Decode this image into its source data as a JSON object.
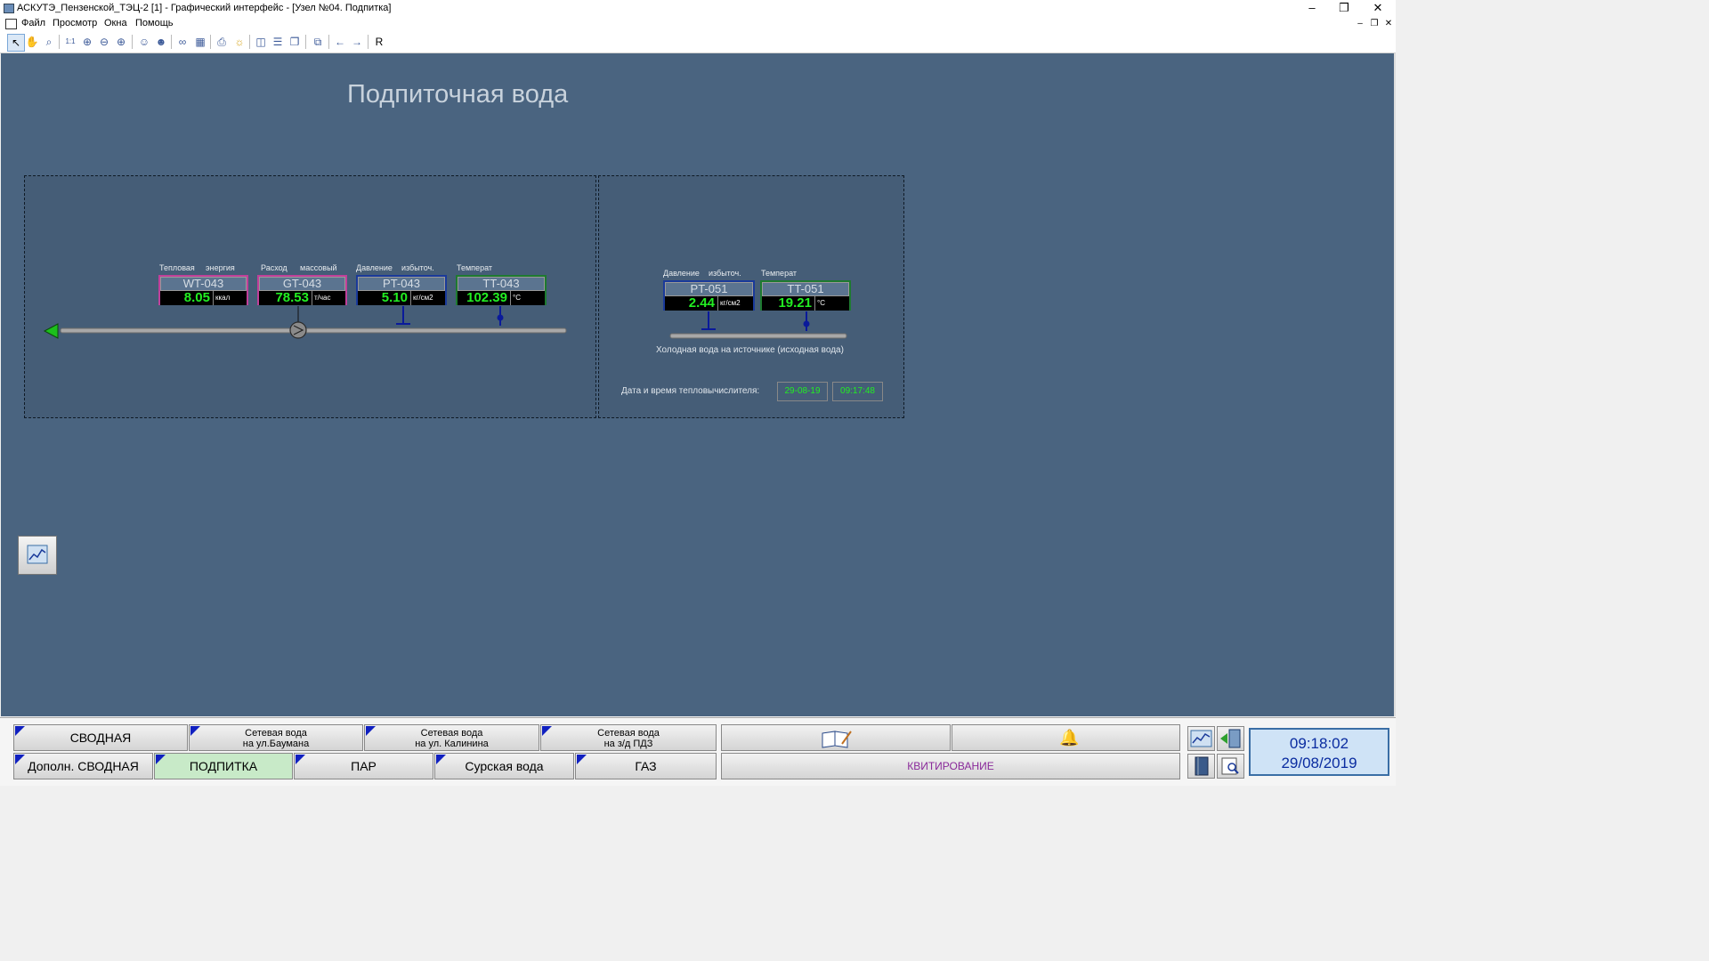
{
  "window": {
    "title": "АСКУТЭ_Пензенской_ТЭЦ-2 [1] - Графический интерфейс - [Узел №04. Подпитка]",
    "controls": {
      "minimize": "–",
      "restore": "❐",
      "close": "✕"
    }
  },
  "menu": [
    "Файл",
    "Просмотр",
    "Окна",
    "Помощь"
  ],
  "toolbar": {
    "r_label": "R"
  },
  "page": {
    "title": "Подпиточная вода"
  },
  "left_group": {
    "instruments": [
      {
        "label1": "Тепловая",
        "label2": "энергия",
        "tag": "WT-043",
        "value": "8.05",
        "unit": "ккал",
        "border": "#c0409a"
      },
      {
        "label1": "Расход",
        "label2": "массовый",
        "tag": "GT-043",
        "value": "78.53",
        "unit": "т/час",
        "border": "#c0409a"
      },
      {
        "label1": "Давление",
        "label2": "избыточ.",
        "tag": "PT-043",
        "value": "5.10",
        "unit": "кг/см2",
        "border": "#1a3a9a"
      },
      {
        "label1": "Температ",
        "label2": "",
        "tag": "TT-043",
        "value": "102.39",
        "unit": "°C",
        "border": "#1e7a30"
      }
    ]
  },
  "right_group": {
    "instruments": [
      {
        "label1": "Давление",
        "label2": "избыточ.",
        "tag": "PT-051",
        "value": "2.44",
        "unit": "кг/см2",
        "border": "#1a3a9a"
      },
      {
        "label1": "Температ",
        "label2": "",
        "tag": "TT-051",
        "value": "19.21",
        "unit": "°C",
        "border": "#1e7a30"
      }
    ],
    "pipe_caption": "Холодная вода на источнике (исходная вода)",
    "datetime_label": "Дата и время тепловычислителя:",
    "date": "29-08-19",
    "time": "09:17:48"
  },
  "nav": {
    "row1": [
      {
        "line1": "СВОДНАЯ",
        "line2": ""
      },
      {
        "line1": "Сетевая вода",
        "line2": "на ул.Баумана"
      },
      {
        "line1": "Сетевая вода",
        "line2": "на ул. Калинина"
      },
      {
        "line1": "Сетевая вода",
        "line2": "на з/д ПДЗ"
      }
    ],
    "row2": [
      "Дополн. СВОДНАЯ",
      "ПОДПИТКА",
      "ПАР",
      "Сурская вода",
      "ГАЗ"
    ],
    "active": "ПОДПИТКА",
    "ack_label": "КВИТИРОВАНИЕ"
  },
  "clock": {
    "time": "09:18:02",
    "date": "29/08/2019"
  },
  "colors": {
    "background": "#4a6480",
    "value_green": "#22ee22",
    "active_tab": "#c8eac8",
    "ack_text": "#8a2a9a"
  }
}
